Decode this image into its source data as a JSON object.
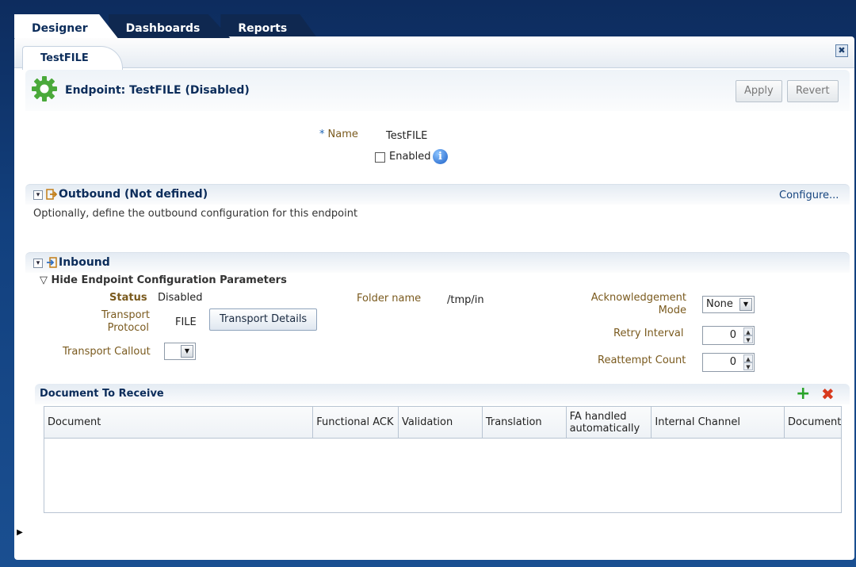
{
  "tabs": [
    "Designer",
    "Dashboards",
    "Reports"
  ],
  "subtab": "TestFILE",
  "close_label": "✖",
  "endpoint": {
    "title": "Endpoint: TestFILE (Disabled)",
    "apply": "Apply",
    "revert": "Revert",
    "name_label": "Name",
    "name_value": "TestFILE",
    "enabled_label": "Enabled",
    "info_glyph": "i"
  },
  "outbound": {
    "title": "Outbound (Not defined)",
    "configure": "Configure...",
    "description": "Optionally, define the outbound configuration for this endpoint"
  },
  "inbound": {
    "title": "Inbound",
    "hide_params": "Hide Endpoint Configuration Parameters",
    "status_label": "Status",
    "status_value": "Disabled",
    "transport_protocol_label_1": "Transport",
    "transport_protocol_label_2": "Protocol",
    "transport_protocol_value": "FILE",
    "transport_details": "Transport Details",
    "transport_callout_label": "Transport Callout",
    "folder_label": "Folder name",
    "folder_value": "/tmp/in",
    "ack_label_1": "Acknowledgement",
    "ack_label_2": "Mode",
    "ack_value": "None",
    "retry_label": "Retry Interval",
    "retry_value": "0",
    "reattempt_label": "Reattempt Count",
    "reattempt_value": "0"
  },
  "doc_table": {
    "title": "Document To Receive",
    "columns": [
      "Document",
      "Functional ACK",
      "Validation",
      "Translation",
      "FA handled automatically",
      "Internal Channel",
      "Document"
    ],
    "rows": []
  },
  "icons": {
    "add": "+",
    "delete": "✖",
    "side_handle": "▶",
    "chevron": "▾"
  },
  "colors": {
    "brand_navy": "#0b2c5a",
    "gear_green": "#4aa93a",
    "add_green": "#29a329",
    "delete_red": "#d83a1e"
  }
}
